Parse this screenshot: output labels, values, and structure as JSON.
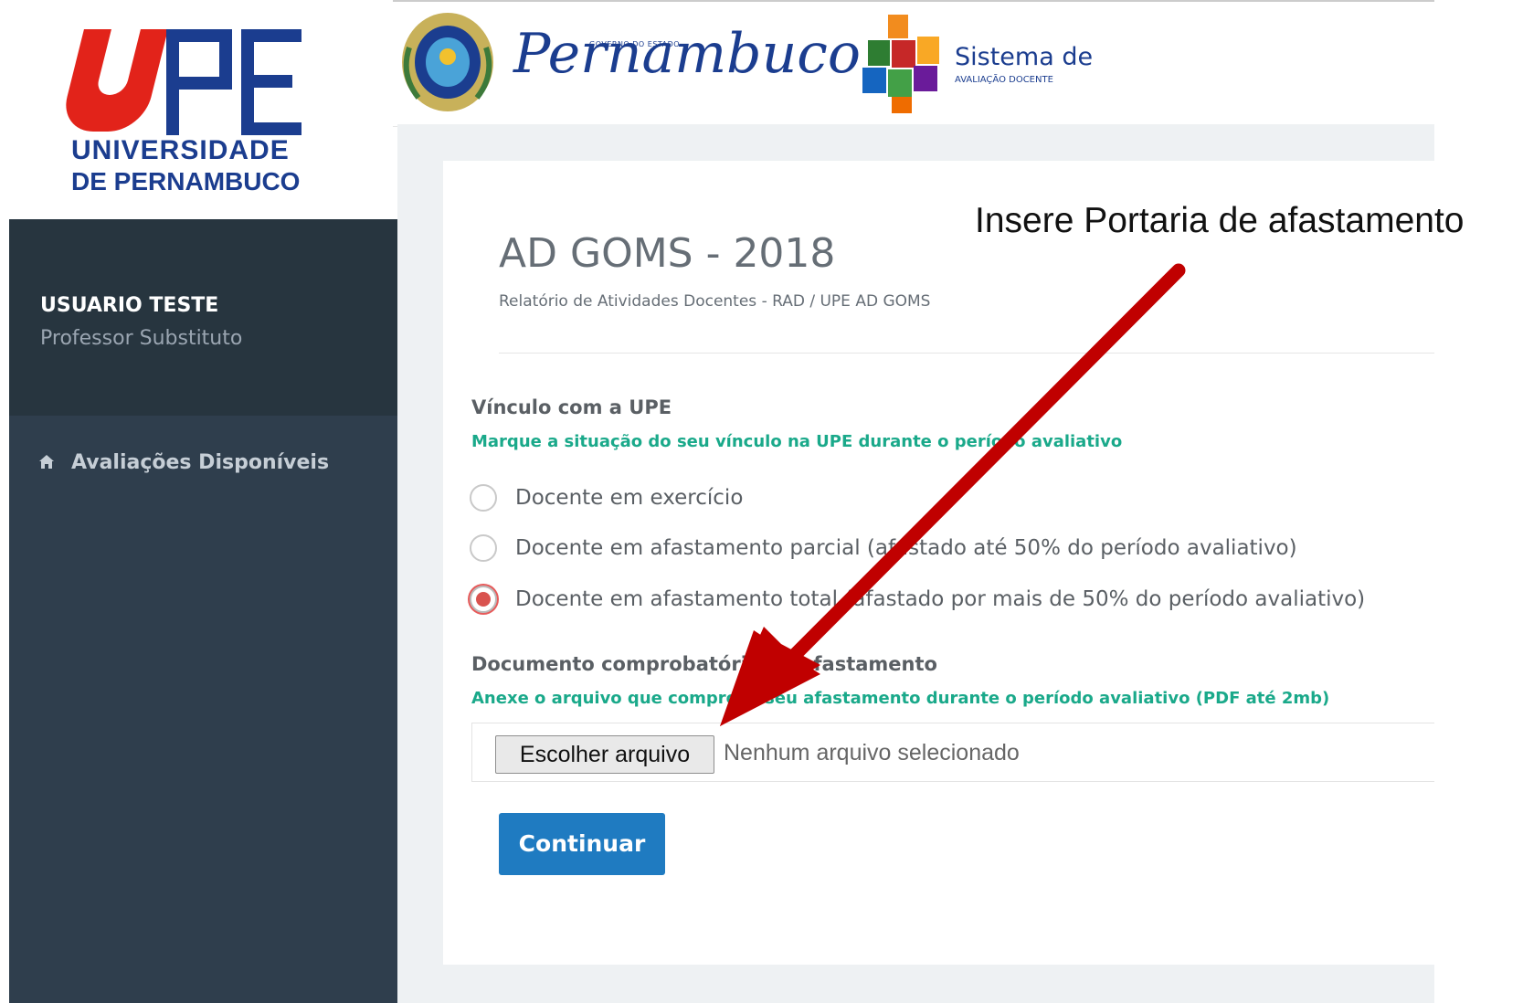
{
  "branding": {
    "upe_line1": "UNIVERSIDADE",
    "upe_line2": "DE PERNAMBUCO",
    "gov_label": "GOVERNO DO ESTADO",
    "state_name": "Pernambuco",
    "system_title": "Sistema de",
    "system_subtitle": "AVALIAÇÃO DOCENTE",
    "colors": {
      "upe_red": "#e2231a",
      "upe_blue": "#1b3d8f",
      "sidebar": "#2f3e4d",
      "accent_green": "#1aa98a",
      "primary_button": "#1f7bc1",
      "radio_selected": "#d9534f"
    }
  },
  "sidebar": {
    "user_name": "USUARIO TESTE",
    "user_role": "Professor Substituto",
    "items": [
      {
        "label": "Avaliações Disponíveis",
        "icon": "home-icon"
      }
    ]
  },
  "page": {
    "title": "AD GOMS - 2018",
    "subtitle": "Relatório de Atividades Docentes - RAD / UPE AD GOMS"
  },
  "form": {
    "vinculo_label": "Vínculo com a UPE",
    "vinculo_hint": "Marque a situação do seu vínculo na UPE durante o período avaliativo",
    "options": [
      {
        "label": "Docente em exercício",
        "selected": false
      },
      {
        "label": "Docente em afastamento parcial (afastado até 50% do período avaliativo)",
        "selected": false
      },
      {
        "label": "Docente em afastamento total (afastado por mais de 50% do período avaliativo)",
        "selected": true
      }
    ],
    "doc_label": "Documento comprobatório de afastamento",
    "doc_hint": "Anexe o arquivo que comprova seu afastamento durante o período avaliativo (PDF até 2mb)",
    "file_button": "Escolher arquivo",
    "file_status": "Nenhum arquivo selecionado",
    "continue_label": "Continuar"
  },
  "annotation": {
    "text": "Insere Portaria de afastamento",
    "arrow_color": "#c00000"
  }
}
